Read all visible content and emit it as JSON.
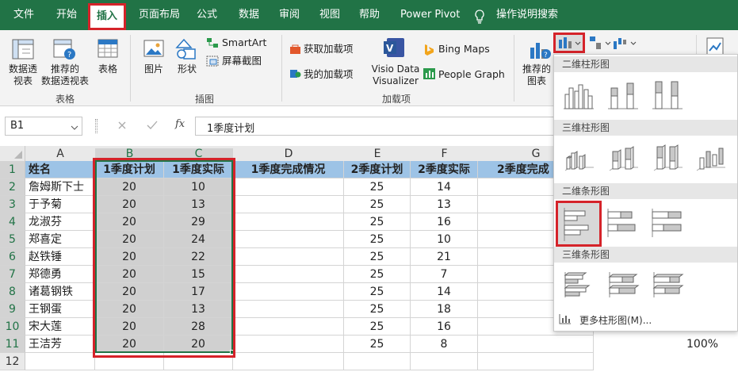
{
  "menu": {
    "file": "文件",
    "home": "开始",
    "insert": "插入",
    "layout": "页面布局",
    "formulas": "公式",
    "data": "数据",
    "review": "审阅",
    "view": "视图",
    "help": "帮助",
    "power_pivot": "Power Pivot",
    "search": "操作说明搜索"
  },
  "ribbon": {
    "pivot": "数据透\n视表",
    "recommended_pivot": "推荐的\n数据透视表",
    "table": "表格",
    "group_tables": "表格",
    "pictures": "图片",
    "shapes": "形状",
    "smartart": "SmartArt",
    "screenshot": "屏幕截图",
    "group_illus": "插图",
    "get_addins": "获取加载项",
    "my_addins": "我的加载项",
    "visio": "Visio Data\nVisualizer",
    "bing": "Bing Maps",
    "people": "People Graph",
    "group_addins": "加载项",
    "recommended_charts": "推荐的\n图表"
  },
  "formula_bar": {
    "namebox": "B1",
    "fx": "fx",
    "value": "1季度计划"
  },
  "columns": [
    "A",
    "B",
    "C",
    "D",
    "E",
    "F",
    "G"
  ],
  "headers": [
    "姓名",
    "1季度计划",
    "1季度实际",
    "1季度完成情况",
    "2季度计划",
    "2季度实际",
    "2季度完成"
  ],
  "rows": [
    [
      "詹姆斯下士",
      "20",
      "10",
      "",
      "25",
      "14"
    ],
    [
      "于予菊",
      "20",
      "13",
      "",
      "25",
      "13"
    ],
    [
      "龙淑芬",
      "20",
      "29",
      "",
      "25",
      "16"
    ],
    [
      "郑喜定",
      "20",
      "24",
      "",
      "25",
      "10"
    ],
    [
      "赵铁锤",
      "20",
      "22",
      "",
      "25",
      "21"
    ],
    [
      "郑德勇",
      "20",
      "15",
      "",
      "25",
      "7"
    ],
    [
      "诸葛钢铁",
      "20",
      "17",
      "",
      "25",
      "14"
    ],
    [
      "王钢蛋",
      "20",
      "13",
      "",
      "25",
      "18"
    ],
    [
      "宋大莲",
      "20",
      "28",
      "",
      "25",
      "16"
    ],
    [
      "王洁芳",
      "20",
      "20",
      "",
      "25",
      "8"
    ]
  ],
  "row_numbers": [
    "1",
    "2",
    "3",
    "4",
    "5",
    "6",
    "7",
    "8",
    "9",
    "10",
    "11",
    "12"
  ],
  "zoom": "100%",
  "dropdown": {
    "col2d": "二维柱形图",
    "col3d": "三维柱形图",
    "bar2d": "二维条形图",
    "bar3d": "三维条形图",
    "more": "更多柱形图(M)..."
  },
  "colors": {
    "excel_green": "#217346",
    "header_blue": "#9dc3e6",
    "highlight_red": "#d5232a"
  }
}
